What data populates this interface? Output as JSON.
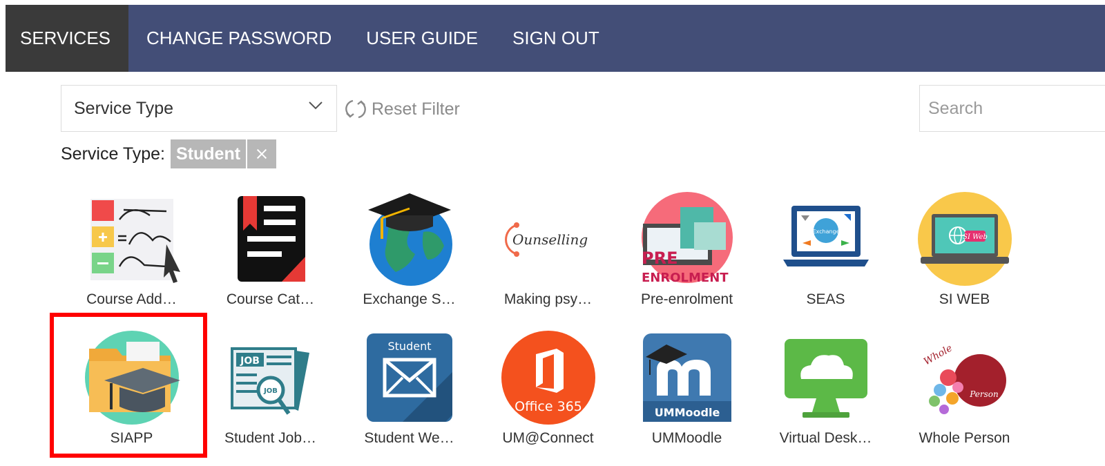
{
  "nav": {
    "items": [
      {
        "label": "SERVICES",
        "active": true
      },
      {
        "label": "CHANGE PASSWORD"
      },
      {
        "label": "USER GUIDE"
      },
      {
        "label": "SIGN OUT"
      }
    ]
  },
  "filter": {
    "select_value": "Service Type",
    "reset_label": "Reset Filter",
    "search_placeholder": "Search",
    "active_label": "Service Type:",
    "chip_value": "Student"
  },
  "services": [
    {
      "label": "Course Add…",
      "icon": "course-add-drop-icon"
    },
    {
      "label": "Course Cat…",
      "icon": "course-catalog-icon"
    },
    {
      "label": "Exchange S…",
      "icon": "exchange-globe-icon"
    },
    {
      "label": "Making psy…",
      "icon": "counselling-icon",
      "icon_text": "Ounselling"
    },
    {
      "label": "Pre-enrolment",
      "icon": "pre-enrolment-icon",
      "icon_text": [
        "PRE",
        "ENROLMENT"
      ]
    },
    {
      "label": "SEAS",
      "icon": "seas-laptop-icon",
      "icon_text": "Exchange"
    },
    {
      "label": "SI WEB",
      "icon": "si-web-icon",
      "icon_text": "SI Web"
    },
    {
      "label": "SIAPP",
      "icon": "siapp-folder-icon",
      "highlighted": true
    },
    {
      "label": "Student Job…",
      "icon": "student-job-icon",
      "icon_text": [
        "JOB",
        "JOB"
      ]
    },
    {
      "label": "Student We…",
      "icon": "student-webmail-icon",
      "icon_text": "Student"
    },
    {
      "label": "UM@Connect",
      "icon": "office365-icon",
      "icon_text": "Office 365"
    },
    {
      "label": "UMMoodle",
      "icon": "ummoodle-icon",
      "icon_text": "UMMoodle"
    },
    {
      "label": "Virtual Desk…",
      "icon": "virtual-desktop-icon"
    },
    {
      "label": "Whole Person",
      "icon": "whole-person-icon",
      "icon_text": [
        "Whole",
        "Person"
      ]
    }
  ],
  "colors": {
    "nav_bg": "#434e77",
    "nav_active": "#3a3a3a",
    "highlight": "#ff0000",
    "chip_bg": "#b7b7b7"
  }
}
